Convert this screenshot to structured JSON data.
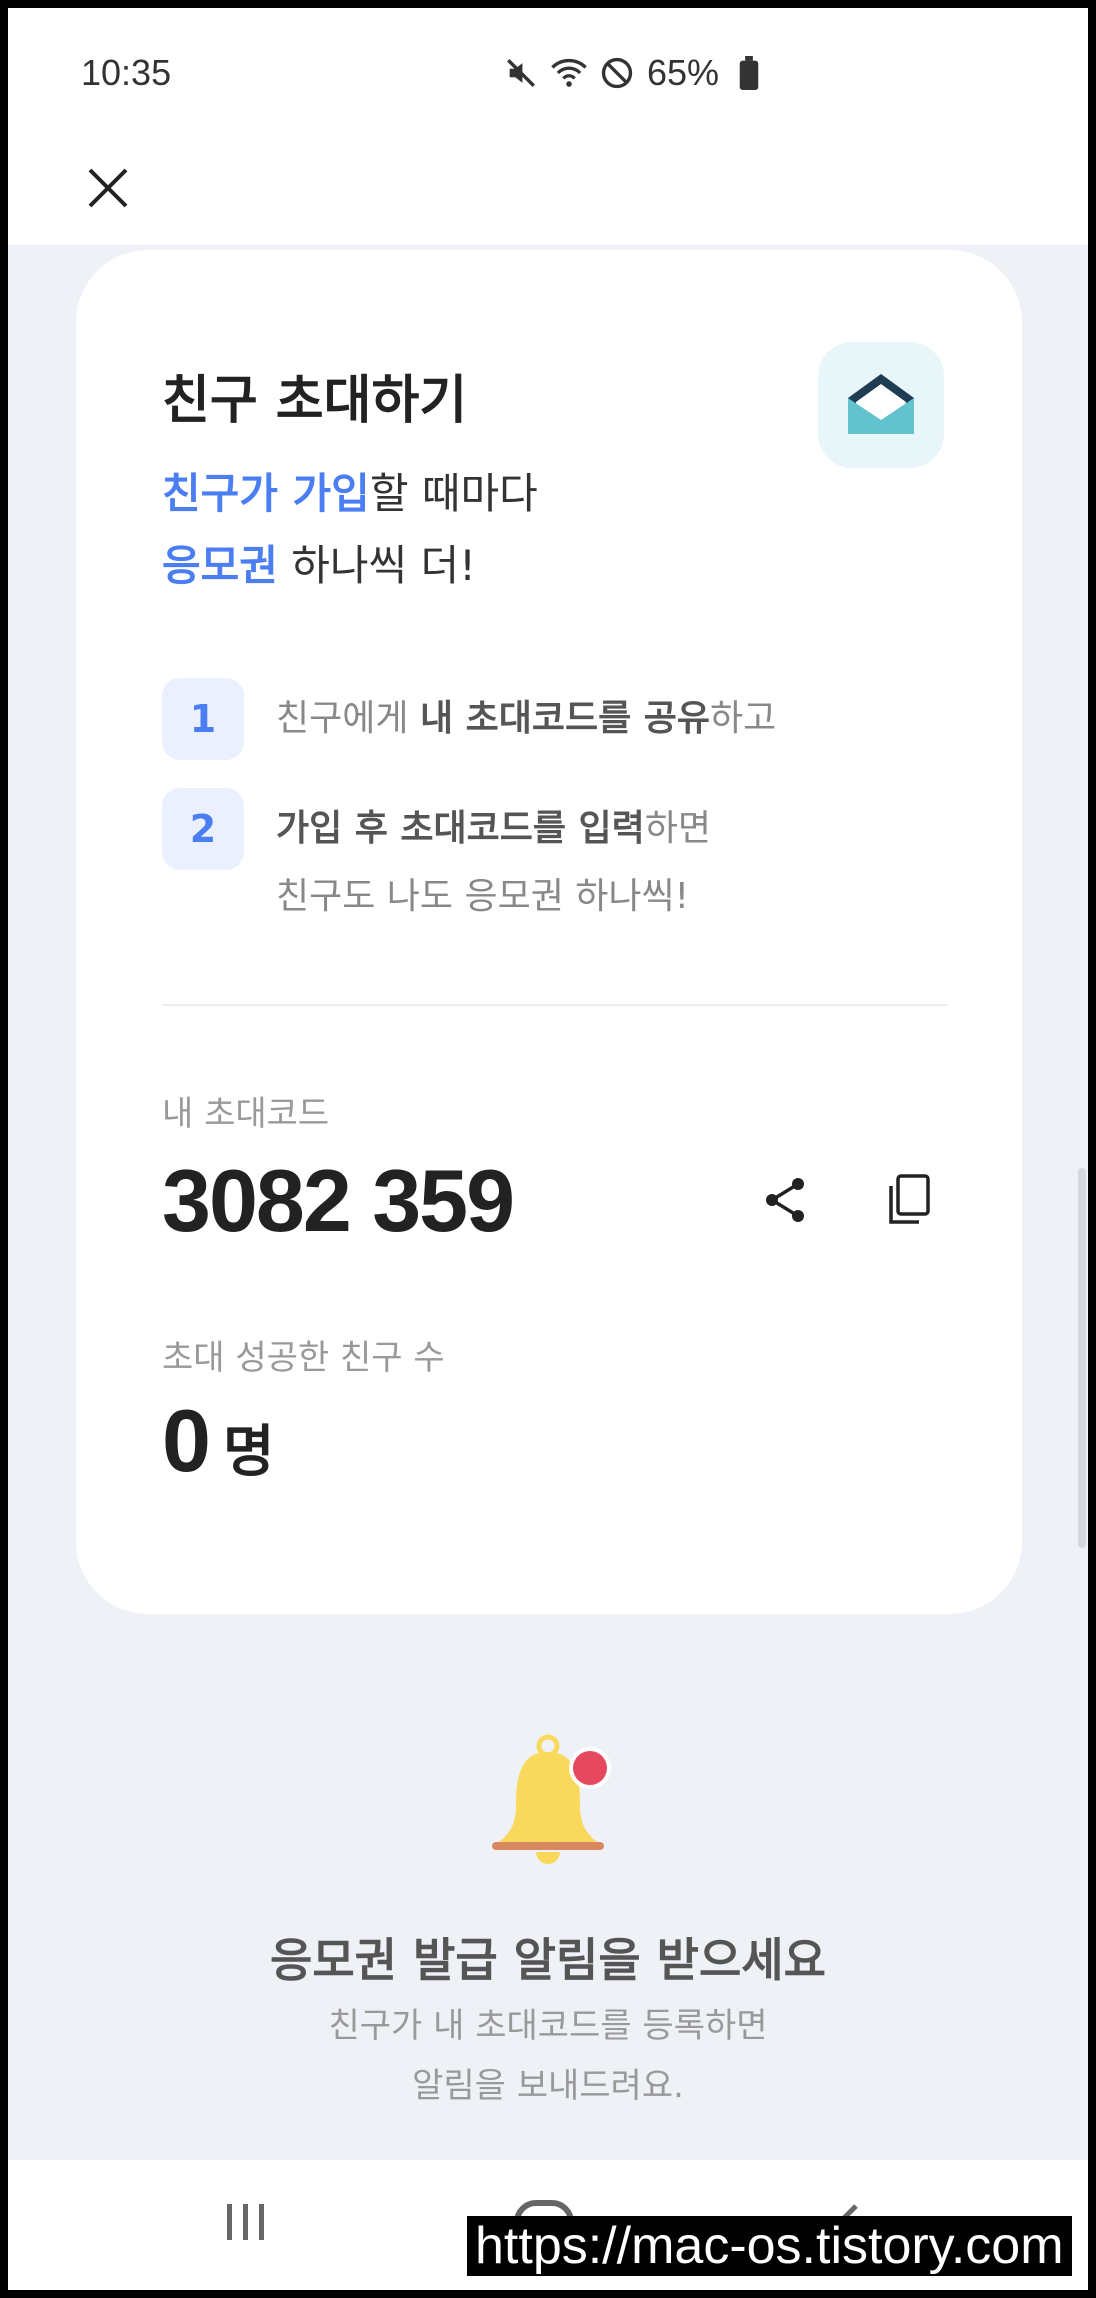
{
  "status_bar": {
    "time": "10:35",
    "battery": "65%",
    "icons": [
      "mute-icon",
      "wifi-icon",
      "do-not-disturb-icon",
      "battery-icon"
    ]
  },
  "app_bar": {
    "close_icon": "close-icon"
  },
  "invite_card": {
    "title": "친구 초대하기",
    "subtitle_line1_highlight": "친구가 가입",
    "subtitle_line1_rest": "할 때마다",
    "subtitle_line2_highlight": "응모권",
    "subtitle_line2_rest": " 하나씩 더!",
    "icon": "envelope-icon",
    "steps": [
      {
        "number": "1",
        "pre": "친구에게 ",
        "bold": "내 초대코드를 공유",
        "post": "하고"
      },
      {
        "number": "2",
        "bold": "가입 후 초대코드를 입력",
        "post": "하면",
        "line2": "친구도 나도 응모권 하나씩!"
      }
    ],
    "code_label": "내 초대코드",
    "code_value": "3082 359",
    "count_label": "초대 성공한 친구 수",
    "count_value": "0",
    "count_unit": "명"
  },
  "notification": {
    "icon": "bell-icon",
    "title": "응모권 발급 알림을 받으세요",
    "desc_line1": "친구가 내 초대코드를 등록하면",
    "desc_line2": "알림을 보내드려요."
  },
  "nav_bar": {
    "icons": [
      "recent-apps-icon",
      "home-icon",
      "back-icon"
    ]
  },
  "watermark": "https://mac-os.tistory.com",
  "colors": {
    "accent": "#4c7ef3",
    "background": "#eef1f6",
    "bell": "#f8d95c",
    "badge": "#e5485f"
  }
}
